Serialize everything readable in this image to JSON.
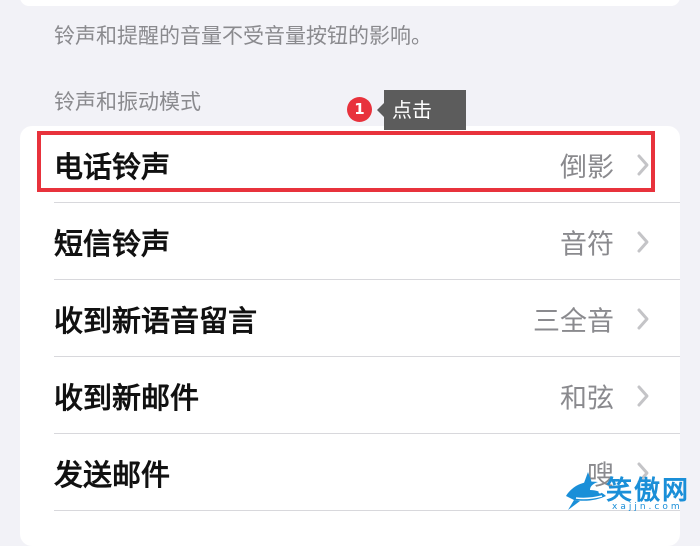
{
  "settings": {
    "footer_note": "铃声和提醒的音量不受音量按钮的影响。",
    "section_header": "铃声和振动模式",
    "rows": [
      {
        "label": "电话铃声",
        "value": "倒影"
      },
      {
        "label": "短信铃声",
        "value": "音符"
      },
      {
        "label": "收到新语音留言",
        "value": "三全音"
      },
      {
        "label": "收到新邮件",
        "value": "和弦"
      },
      {
        "label": "发送邮件",
        "value": "嗖"
      }
    ]
  },
  "annotation": {
    "step": "1",
    "tooltip": "点击",
    "highlight_color": "#e8323c"
  },
  "watermark": {
    "text": "笑傲网",
    "url": "xajjn.com",
    "color": "#1a8fd8"
  }
}
